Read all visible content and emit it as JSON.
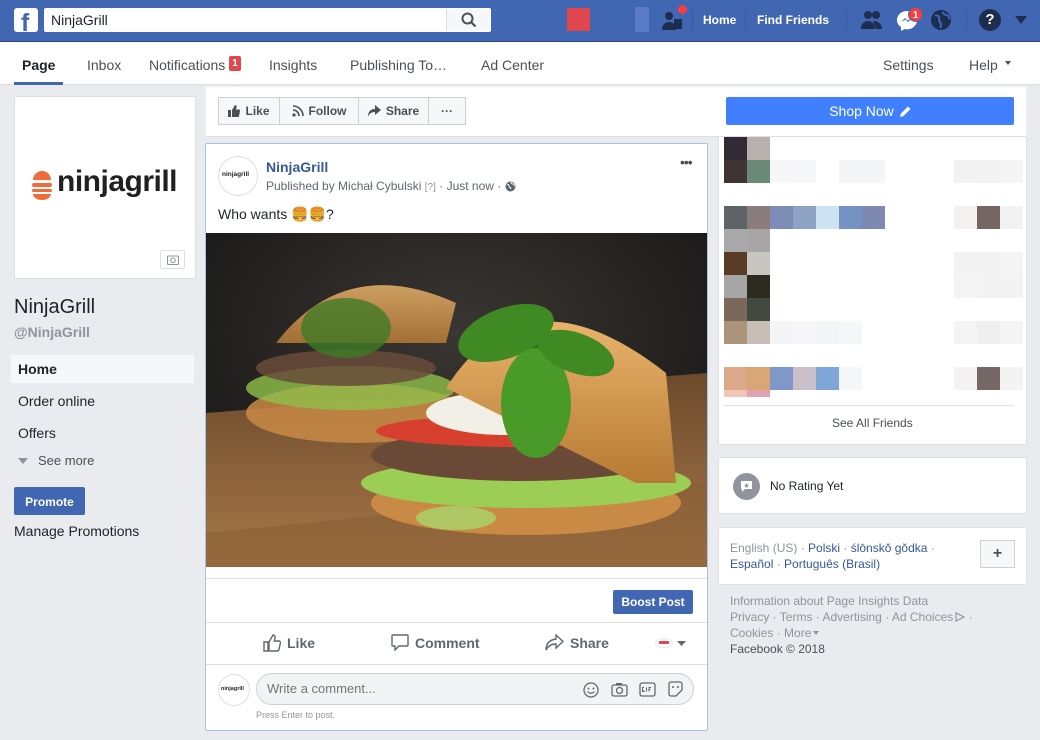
{
  "topbar": {
    "logo_letter": "f",
    "search_value": "NinjaGrill",
    "home_label": "Home",
    "find_friends_label": "Find Friends",
    "messenger_badge": "1",
    "help_glyph": "?"
  },
  "page_nav": {
    "tabs": [
      {
        "label": "Page"
      },
      {
        "label": "Inbox"
      },
      {
        "label": "Notifications"
      },
      {
        "label": "Insights"
      },
      {
        "label": "Publishing To…"
      },
      {
        "label": "Ad Center"
      }
    ],
    "notifications_badge": "1",
    "settings_label": "Settings",
    "help_label": "Help"
  },
  "left": {
    "logo_text": "ninjagrill",
    "page_name": "NinjaGrill",
    "handle": "@NinjaGrill",
    "nav": [
      {
        "label": "Home"
      },
      {
        "label": "Order online"
      },
      {
        "label": "Offers"
      }
    ],
    "see_more": "See more",
    "promote": "Promote",
    "manage_promotions": "Manage Promotions"
  },
  "action_bar": {
    "like": "Like",
    "follow": "Follow",
    "share": "Share",
    "more": "···",
    "shop_now": "Shop Now"
  },
  "post": {
    "author": "NinjaGrill",
    "avatar_text": "ninjagrill",
    "meta_published": "Published by Michał Cybulski",
    "meta_q": "[?]",
    "meta_time": "Just now",
    "text": "Who wants 🍔🍔?",
    "options": "•••",
    "boost": "Boost Post",
    "like": "Like",
    "comment": "Comment",
    "share": "Share",
    "comment_placeholder": "Write a comment...",
    "press_enter": "Press Enter to post."
  },
  "right": {
    "see_all_friends": "See All Friends",
    "rating": "No Rating Yet",
    "languages": {
      "current": "English (US)",
      "polski": "Polski",
      "silesian": "ślōnskŏ gŏdka",
      "espanol": "Español",
      "portugues": "Português (Brasil)"
    },
    "footer": {
      "insights": "Information about Page Insights Data",
      "privacy": "Privacy",
      "terms": "Terms",
      "advertising": "Advertising",
      "ad_choices": "Ad Choices",
      "cookies": "Cookies",
      "more": "More",
      "copyright": "Facebook © 2018"
    }
  },
  "colors": {
    "brand_blue": "#4267b2",
    "shop_blue": "#4080ff",
    "badge_red": "#fa3e3e",
    "logo_orange": "#f26b3a"
  }
}
